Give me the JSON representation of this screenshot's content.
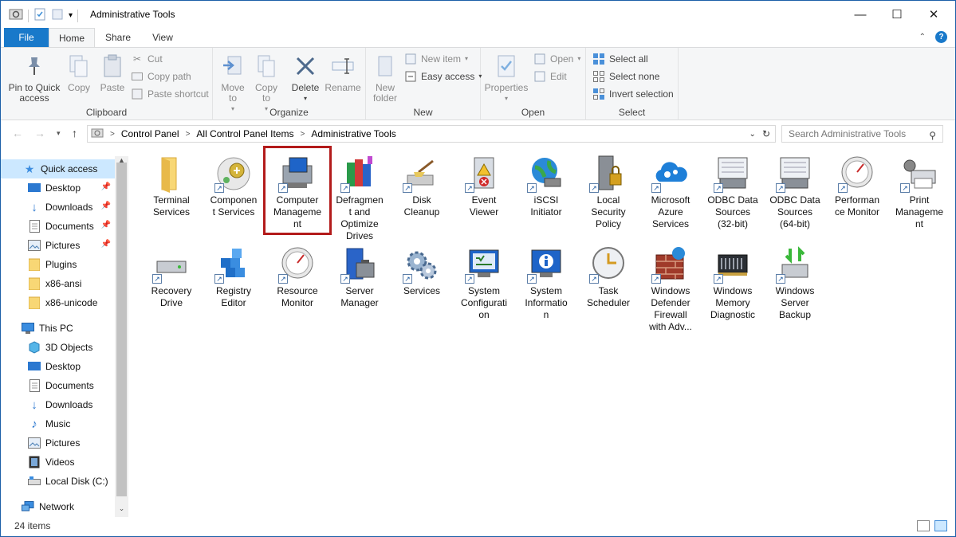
{
  "window": {
    "title": "Administrative Tools",
    "controls": {
      "minimize": "—",
      "maximize": "☐",
      "close": "✕"
    }
  },
  "ribbon_tabs": {
    "file": "File",
    "home": "Home",
    "share": "Share",
    "view": "View",
    "help": "?"
  },
  "ribbon": {
    "clipboard": {
      "label": "Clipboard",
      "pin": "Pin to Quick access",
      "copy": "Copy",
      "paste": "Paste",
      "cut": "Cut",
      "copy_path": "Copy path",
      "paste_shortcut": "Paste shortcut"
    },
    "organize": {
      "label": "Organize",
      "move_to": "Move to",
      "copy_to": "Copy to",
      "delete": "Delete",
      "rename": "Rename"
    },
    "new": {
      "label": "New",
      "new_folder": "New folder",
      "new_item": "New item",
      "easy_access": "Easy access"
    },
    "open": {
      "label": "Open",
      "properties": "Properties",
      "open": "Open",
      "edit": "Edit"
    },
    "select": {
      "label": "Select",
      "select_all": "Select all",
      "select_none": "Select none",
      "invert_selection": "Invert selection"
    }
  },
  "address": {
    "crumbs": [
      "Control Panel",
      "All Control Panel Items",
      "Administrative Tools"
    ],
    "search_placeholder": "Search Administrative Tools"
  },
  "nav": {
    "quick_access": "Quick access",
    "quick_items": [
      "Desktop",
      "Downloads",
      "Documents",
      "Pictures",
      "Plugins",
      "x86-ansi",
      "x86-unicode"
    ],
    "this_pc": "This PC",
    "pc_items": [
      "3D Objects",
      "Desktop",
      "Documents",
      "Downloads",
      "Music",
      "Pictures",
      "Videos",
      "Local Disk (C:)"
    ],
    "network": "Network"
  },
  "items": [
    {
      "l1": "Terminal",
      "l2": "Services",
      "l3": "",
      "l4": "",
      "icon": "folder-icon"
    },
    {
      "l1": "Componen",
      "l2": "t Services",
      "l3": "",
      "l4": "",
      "icon": "component-services-icon"
    },
    {
      "l1": "Computer",
      "l2": "Manageme",
      "l3": "nt",
      "l4": "",
      "icon": "computer-management-icon"
    },
    {
      "l1": "Defragmen",
      "l2": "t and",
      "l3": "Optimize",
      "l4": "Drives",
      "icon": "defragment-icon"
    },
    {
      "l1": "Disk",
      "l2": "Cleanup",
      "l3": "",
      "l4": "",
      "icon": "disk-cleanup-icon"
    },
    {
      "l1": "Event",
      "l2": "Viewer",
      "l3": "",
      "l4": "",
      "icon": "event-viewer-icon"
    },
    {
      "l1": "iSCSI",
      "l2": "Initiator",
      "l3": "",
      "l4": "",
      "icon": "iscsi-initiator-icon"
    },
    {
      "l1": "Local",
      "l2": "Security",
      "l3": "Policy",
      "l4": "",
      "icon": "local-security-policy-icon"
    },
    {
      "l1": "Microsoft",
      "l2": "Azure",
      "l3": "Services",
      "l4": "",
      "icon": "azure-cloud-icon"
    },
    {
      "l1": "ODBC Data",
      "l2": "Sources",
      "l3": "(32-bit)",
      "l4": "",
      "icon": "odbc-icon"
    },
    {
      "l1": "ODBC Data",
      "l2": "Sources",
      "l3": "(64-bit)",
      "l4": "",
      "icon": "odbc-icon"
    },
    {
      "l1": "Performan",
      "l2": "ce Monitor",
      "l3": "",
      "l4": "",
      "icon": "performance-monitor-icon"
    },
    {
      "l1": "Print",
      "l2": "Manageme",
      "l3": "nt",
      "l4": "",
      "icon": "print-management-icon"
    },
    {
      "l1": "Recovery",
      "l2": "Drive",
      "l3": "",
      "l4": "",
      "icon": "recovery-drive-icon"
    },
    {
      "l1": "Registry",
      "l2": "Editor",
      "l3": "",
      "l4": "",
      "icon": "registry-editor-icon"
    },
    {
      "l1": "Resource",
      "l2": "Monitor",
      "l3": "",
      "l4": "",
      "icon": "resource-monitor-icon"
    },
    {
      "l1": "Server",
      "l2": "Manager",
      "l3": "",
      "l4": "",
      "icon": "server-manager-icon"
    },
    {
      "l1": "Services",
      "l2": "",
      "l3": "",
      "l4": "",
      "icon": "services-gear-icon"
    },
    {
      "l1": "System",
      "l2": "Configurati",
      "l3": "on",
      "l4": "",
      "icon": "system-configuration-icon"
    },
    {
      "l1": "System",
      "l2": "Informatio",
      "l3": "n",
      "l4": "",
      "icon": "system-information-icon"
    },
    {
      "l1": "Task",
      "l2": "Scheduler",
      "l3": "",
      "l4": "",
      "icon": "task-scheduler-icon"
    },
    {
      "l1": "Windows",
      "l2": "Defender",
      "l3": "Firewall",
      "l4": "with Adv...",
      "icon": "firewall-icon"
    },
    {
      "l1": "Windows",
      "l2": "Memory",
      "l3": "Diagnostic",
      "l4": "",
      "icon": "memory-diagnostic-icon"
    },
    {
      "l1": "Windows",
      "l2": "Server",
      "l3": "Backup",
      "l4": "",
      "icon": "server-backup-icon"
    }
  ],
  "status": {
    "count": "24 items"
  },
  "colors": {
    "accent": "#1979ca",
    "selection": "#cce8ff",
    "highlight_box": "#b31b1b"
  }
}
